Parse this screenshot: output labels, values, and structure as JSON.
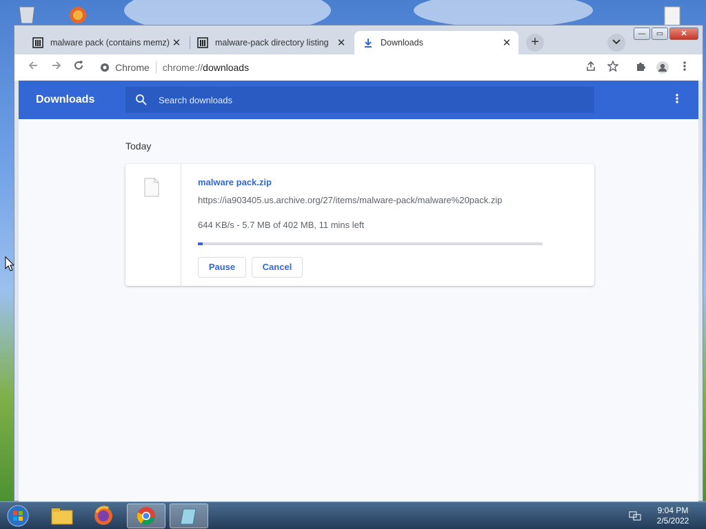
{
  "browser": {
    "tabs": [
      {
        "title": "malware pack (contains memz) : F",
        "icon": "archive-icon",
        "close": "✕"
      },
      {
        "title": "malware-pack directory listing",
        "icon": "archive-icon",
        "close": "✕"
      },
      {
        "title": "Downloads",
        "icon": "download-icon",
        "close": "✕"
      }
    ],
    "new_tab": "+",
    "window_controls": {
      "minimize": "—",
      "maximize": "▭",
      "close": "✕"
    },
    "omnibox": {
      "site": "Chrome",
      "url_scheme": "chrome://",
      "url_path": "downloads"
    }
  },
  "downloads_page": {
    "title": "Downloads",
    "search_placeholder": "Search downloads",
    "section": "Today",
    "items": [
      {
        "filename": "malware pack.zip",
        "url": "https://ia903405.us.archive.org/27/items/malware-pack/malware%20pack.zip",
        "status": "644 KB/s - 5.7 MB of 402 MB, 11 mins left",
        "progress_fraction": 0.014,
        "pause_label": "Pause",
        "cancel_label": "Cancel"
      }
    ],
    "accent_color": "#3367d6"
  },
  "taskbar": {
    "apps": [
      "start-orb-icon",
      "file-explorer-icon",
      "firefox-icon",
      "chrome-icon",
      "notepad-icon"
    ],
    "clock_time": "9:04 PM",
    "clock_date": "2/5/2022"
  }
}
